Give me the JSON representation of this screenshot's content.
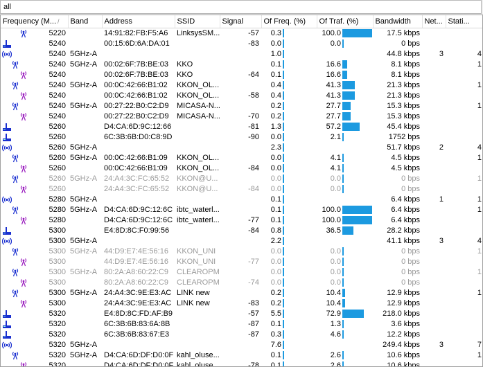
{
  "filter": {
    "value": "all"
  },
  "columns": [
    "Frequency (M...",
    "Band",
    "Address",
    "SSID",
    "Signal",
    "Of Freq. (%)",
    "Of Traf. (%)",
    "Bandwidth",
    "Net...",
    "Stati..."
  ],
  "sort_indicator": "/",
  "colors": {
    "bar": "#1c9ae0",
    "icon_blue": "#1a2fd0",
    "icon_purple": "#9b1fbf",
    "dim_text": "#9a9a9a"
  },
  "rows": [
    {
      "icon": "ap",
      "indent": 2,
      "freq": "5220",
      "band": "",
      "addr": "14:91:82:FB:F5:A6",
      "ssid": "LinksysSM...",
      "signal": "-57",
      "offreq": "0.3",
      "oftraf": "100.0",
      "traf_pct": 100,
      "bw": "17.5 kbps",
      "net": "",
      "sta": "",
      "dim": false
    },
    {
      "icon": "client",
      "indent": 0,
      "freq": "5240",
      "band": "",
      "addr": "00:15:6D:6A:DA:01",
      "ssid": "",
      "signal": "-83",
      "offreq": "0.0",
      "oftraf": "0.0",
      "traf_pct": 0,
      "bw": "0 bps",
      "net": "",
      "sta": "",
      "dim": false
    },
    {
      "icon": "net",
      "indent": 0,
      "freq": "5240",
      "band": "5GHz-A",
      "addr": "",
      "ssid": "",
      "signal": "",
      "offreq": "1.0",
      "oftraf": "",
      "traf_pct": 0,
      "bw": "44.8 kbps",
      "net": "3",
      "sta": "4",
      "dim": false
    },
    {
      "icon": "ap",
      "indent": 1,
      "freq": "5240",
      "band": "5GHz-A",
      "addr": "00:02:6F:7B:BE:03",
      "ssid": "KKO",
      "signal": "",
      "offreq": "0.1",
      "oftraf": "16.6",
      "traf_pct": 16.6,
      "bw": "8.1 kbps",
      "net": "",
      "sta": "1",
      "dim": false
    },
    {
      "icon": "sta",
      "indent": 2,
      "freq": "5240",
      "band": "",
      "addr": "00:02:6F:7B:BE:03",
      "ssid": "KKO",
      "signal": "-64",
      "offreq": "0.1",
      "oftraf": "16.6",
      "traf_pct": 16.6,
      "bw": "8.1 kbps",
      "net": "",
      "sta": "",
      "dim": false
    },
    {
      "icon": "ap",
      "indent": 1,
      "freq": "5240",
      "band": "5GHz-A",
      "addr": "00:0C:42:66:B1:02",
      "ssid": "KKON_OL...",
      "signal": "",
      "offreq": "0.4",
      "oftraf": "41.3",
      "traf_pct": 41.3,
      "bw": "21.3 kbps",
      "net": "",
      "sta": "1",
      "dim": false
    },
    {
      "icon": "sta",
      "indent": 2,
      "freq": "5240",
      "band": "",
      "addr": "00:0C:42:66:B1:02",
      "ssid": "KKON_OL...",
      "signal": "-58",
      "offreq": "0.4",
      "oftraf": "41.3",
      "traf_pct": 41.3,
      "bw": "21.3 kbps",
      "net": "",
      "sta": "",
      "dim": false
    },
    {
      "icon": "ap",
      "indent": 1,
      "freq": "5240",
      "band": "5GHz-A",
      "addr": "00:27:22:B0:C2:D9",
      "ssid": "MICASA-N...",
      "signal": "",
      "offreq": "0.2",
      "oftraf": "27.7",
      "traf_pct": 27.7,
      "bw": "15.3 kbps",
      "net": "",
      "sta": "1",
      "dim": false
    },
    {
      "icon": "sta",
      "indent": 2,
      "freq": "5240",
      "band": "",
      "addr": "00:27:22:B0:C2:D9",
      "ssid": "MICASA-N...",
      "signal": "-70",
      "offreq": "0.2",
      "oftraf": "27.7",
      "traf_pct": 27.7,
      "bw": "15.3 kbps",
      "net": "",
      "sta": "",
      "dim": false
    },
    {
      "icon": "client",
      "indent": 0,
      "freq": "5260",
      "band": "",
      "addr": "D4:CA:6D:9C:12:66",
      "ssid": "",
      "signal": "-81",
      "offreq": "1.3",
      "oftraf": "57.2",
      "traf_pct": 57.2,
      "bw": "45.4 kbps",
      "net": "",
      "sta": "",
      "dim": false
    },
    {
      "icon": "client",
      "indent": 0,
      "freq": "5260",
      "band": "",
      "addr": "6C:3B:6B:D0:C8:9D",
      "ssid": "",
      "signal": "-90",
      "offreq": "0.0",
      "oftraf": "2.1",
      "traf_pct": 2.1,
      "bw": "1752 bps",
      "net": "",
      "sta": "",
      "dim": false
    },
    {
      "icon": "net",
      "indent": 0,
      "freq": "5260",
      "band": "5GHz-A",
      "addr": "",
      "ssid": "",
      "signal": "",
      "offreq": "2.3",
      "oftraf": "",
      "traf_pct": 0,
      "bw": "51.7 kbps",
      "net": "2",
      "sta": "4",
      "dim": false
    },
    {
      "icon": "ap",
      "indent": 1,
      "freq": "5260",
      "band": "5GHz-A",
      "addr": "00:0C:42:66:B1:09",
      "ssid": "KKON_OL...",
      "signal": "",
      "offreq": "0.0",
      "oftraf": "4.1",
      "traf_pct": 4.1,
      "bw": "4.5 kbps",
      "net": "",
      "sta": "1",
      "dim": false
    },
    {
      "icon": "sta",
      "indent": 2,
      "freq": "5260",
      "band": "",
      "addr": "00:0C:42:66:B1:09",
      "ssid": "KKON_OL...",
      "signal": "-84",
      "offreq": "0.0",
      "oftraf": "4.1",
      "traf_pct": 4.1,
      "bw": "4.5 kbps",
      "net": "",
      "sta": "",
      "dim": false
    },
    {
      "icon": "ap",
      "indent": 1,
      "freq": "5260",
      "band": "5GHz-A",
      "addr": "24:A4:3C:FC:65:52",
      "ssid": "KKON@U...",
      "signal": "",
      "offreq": "0.0",
      "oftraf": "0.0",
      "traf_pct": 0,
      "bw": "0 bps",
      "net": "",
      "sta": "1",
      "dim": true
    },
    {
      "icon": "sta",
      "indent": 2,
      "freq": "5260",
      "band": "",
      "addr": "24:A4:3C:FC:65:52",
      "ssid": "KKON@U...",
      "signal": "-84",
      "offreq": "0.0",
      "oftraf": "0.0",
      "traf_pct": 0,
      "bw": "0 bps",
      "net": "",
      "sta": "",
      "dim": true
    },
    {
      "icon": "net",
      "indent": 0,
      "freq": "5280",
      "band": "5GHz-A",
      "addr": "",
      "ssid": "",
      "signal": "",
      "offreq": "0.1",
      "oftraf": "",
      "traf_pct": 0,
      "bw": "6.4 kbps",
      "net": "1",
      "sta": "1",
      "dim": false
    },
    {
      "icon": "ap",
      "indent": 1,
      "freq": "5280",
      "band": "5GHz-A",
      "addr": "D4:CA:6D:9C:12:6C",
      "ssid": "ibtc_waterl...",
      "signal": "",
      "offreq": "0.1",
      "oftraf": "100.0",
      "traf_pct": 100,
      "bw": "6.4 kbps",
      "net": "",
      "sta": "1",
      "dim": false
    },
    {
      "icon": "sta",
      "indent": 2,
      "freq": "5280",
      "band": "",
      "addr": "D4:CA:6D:9C:12:6C",
      "ssid": "ibtc_waterl...",
      "signal": "-77",
      "offreq": "0.1",
      "oftraf": "100.0",
      "traf_pct": 100,
      "bw": "6.4 kbps",
      "net": "",
      "sta": "",
      "dim": false
    },
    {
      "icon": "client",
      "indent": 0,
      "freq": "5300",
      "band": "",
      "addr": "E4:8D:8C:F0:99:56",
      "ssid": "",
      "signal": "-84",
      "offreq": "0.8",
      "oftraf": "36.5",
      "traf_pct": 36.5,
      "bw": "28.2 kbps",
      "net": "",
      "sta": "",
      "dim": false
    },
    {
      "icon": "net",
      "indent": 0,
      "freq": "5300",
      "band": "5GHz-A",
      "addr": "",
      "ssid": "",
      "signal": "",
      "offreq": "2.2",
      "oftraf": "",
      "traf_pct": 0,
      "bw": "41.1 kbps",
      "net": "3",
      "sta": "4",
      "dim": false
    },
    {
      "icon": "ap",
      "indent": 1,
      "freq": "5300",
      "band": "5GHz-A",
      "addr": "44:D9:E7:4E:56:16",
      "ssid": "KKON_UNI",
      "signal": "",
      "offreq": "0.0",
      "oftraf": "0.0",
      "traf_pct": 0,
      "bw": "0 bps",
      "net": "",
      "sta": "1",
      "dim": true
    },
    {
      "icon": "sta",
      "indent": 2,
      "freq": "5300",
      "band": "",
      "addr": "44:D9:E7:4E:56:16",
      "ssid": "KKON_UNI",
      "signal": "-77",
      "offreq": "0.0",
      "oftraf": "0.0",
      "traf_pct": 0,
      "bw": "0 bps",
      "net": "",
      "sta": "",
      "dim": true
    },
    {
      "icon": "ap",
      "indent": 1,
      "freq": "5300",
      "band": "5GHz-A",
      "addr": "80:2A:A8:60:22:C9",
      "ssid": "CLEAROPM",
      "signal": "",
      "offreq": "0.0",
      "oftraf": "0.0",
      "traf_pct": 0,
      "bw": "0 bps",
      "net": "",
      "sta": "1",
      "dim": true
    },
    {
      "icon": "sta",
      "indent": 2,
      "freq": "5300",
      "band": "",
      "addr": "80:2A:A8:60:22:C9",
      "ssid": "CLEAROPM",
      "signal": "-74",
      "offreq": "0.0",
      "oftraf": "0.0",
      "traf_pct": 0,
      "bw": "0 bps",
      "net": "",
      "sta": "",
      "dim": true
    },
    {
      "icon": "ap",
      "indent": 1,
      "freq": "5300",
      "band": "5GHz-A",
      "addr": "24:A4:3C:9E:E3:AC",
      "ssid": "LINK new",
      "signal": "",
      "offreq": "0.2",
      "oftraf": "10.4",
      "traf_pct": 10.4,
      "bw": "12.9 kbps",
      "net": "",
      "sta": "1",
      "dim": false
    },
    {
      "icon": "sta",
      "indent": 2,
      "freq": "5300",
      "band": "",
      "addr": "24:A4:3C:9E:E3:AC",
      "ssid": "LINK new",
      "signal": "-83",
      "offreq": "0.2",
      "oftraf": "10.4",
      "traf_pct": 10.4,
      "bw": "12.9 kbps",
      "net": "",
      "sta": "",
      "dim": false
    },
    {
      "icon": "client",
      "indent": 0,
      "freq": "5320",
      "band": "",
      "addr": "E4:8D:8C:FD:AF:B9",
      "ssid": "",
      "signal": "-57",
      "offreq": "5.5",
      "oftraf": "72.9",
      "traf_pct": 72.9,
      "bw": "218.0 kbps",
      "net": "",
      "sta": "",
      "dim": false
    },
    {
      "icon": "client",
      "indent": 0,
      "freq": "5320",
      "band": "",
      "addr": "6C:3B:6B:83:6A:8B",
      "ssid": "",
      "signal": "-87",
      "offreq": "0.1",
      "oftraf": "1.3",
      "traf_pct": 1.3,
      "bw": "3.6 kbps",
      "net": "",
      "sta": "",
      "dim": false
    },
    {
      "icon": "client",
      "indent": 0,
      "freq": "5320",
      "band": "",
      "addr": "6C:3B:6B:83:67:E3",
      "ssid": "",
      "signal": "-87",
      "offreq": "0.3",
      "oftraf": "4.6",
      "traf_pct": 4.6,
      "bw": "12.2 kbps",
      "net": "",
      "sta": "",
      "dim": false
    },
    {
      "icon": "net",
      "indent": 0,
      "freq": "5320",
      "band": "5GHz-A",
      "addr": "",
      "ssid": "",
      "signal": "",
      "offreq": "7.6",
      "oftraf": "",
      "traf_pct": 0,
      "bw": "249.4 kbps",
      "net": "3",
      "sta": "7",
      "dim": false
    },
    {
      "icon": "ap",
      "indent": 1,
      "freq": "5320",
      "band": "5GHz-A",
      "addr": "D4:CA:6D:DF:D0:0F",
      "ssid": "kahl_oluse...",
      "signal": "",
      "offreq": "0.1",
      "oftraf": "2.6",
      "traf_pct": 2.6,
      "bw": "10.6 kbps",
      "net": "",
      "sta": "1",
      "dim": false
    },
    {
      "icon": "sta",
      "indent": 2,
      "freq": "5320",
      "band": "",
      "addr": "D4:CA:6D:DF:D0:0F",
      "ssid": "kahl_oluse...",
      "signal": "-78",
      "offreq": "0.1",
      "oftraf": "2.6",
      "traf_pct": 2.6,
      "bw": "10.6 kbps",
      "net": "",
      "sta": "",
      "dim": false
    }
  ]
}
